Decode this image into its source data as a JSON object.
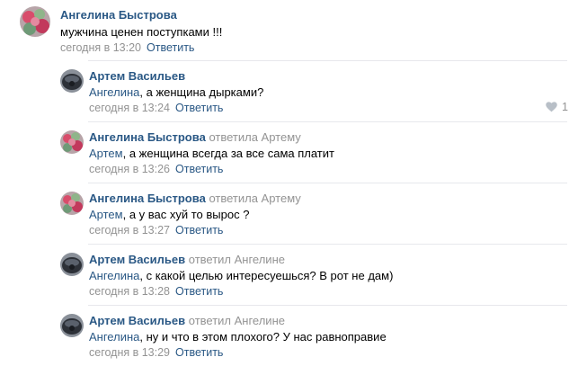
{
  "comments": [
    {
      "author": "Ангелина Быстрова",
      "reply_to": "",
      "mention": "",
      "text": "мужчина ценен поступками !!!",
      "time": "сегодня в 13:20",
      "reply_label": "Ответить"
    },
    {
      "author": "Артем Васильев",
      "reply_to": "",
      "mention": "Ангелина",
      "text": ", а женщина дырками?",
      "time": "сегодня в 13:24",
      "reply_label": "Ответить",
      "likes": "1"
    },
    {
      "author": "Ангелина Быстрова",
      "reply_to": "ответила Артему",
      "mention": "Артем",
      "text": ", а женщина всегда за все сама платит",
      "time": "сегодня в 13:26",
      "reply_label": "Ответить"
    },
    {
      "author": "Ангелина Быстрова",
      "reply_to": "ответила Артему",
      "mention": "Артем",
      "text": ", а у вас хуй то вырос ?",
      "time": "сегодня в 13:27",
      "reply_label": "Ответить"
    },
    {
      "author": "Артем Васильев",
      "reply_to": "ответил Ангелине",
      "mention": "Ангелина",
      "text": ", с какой целью интересуешься? В рот не дам)",
      "time": "сегодня в 13:28",
      "reply_label": "Ответить"
    },
    {
      "author": "Артем Васильев",
      "reply_to": "ответил Ангелине",
      "mention": "Ангелина",
      "text": ", ну и что в этом плохого? У нас равноправие",
      "time": "сегодня в 13:29",
      "reply_label": "Ответить"
    }
  ],
  "colors": {
    "link": "#2a5885",
    "meta": "#939393",
    "divider": "#e7e8ec"
  },
  "icons": {
    "like": "heart-icon"
  }
}
